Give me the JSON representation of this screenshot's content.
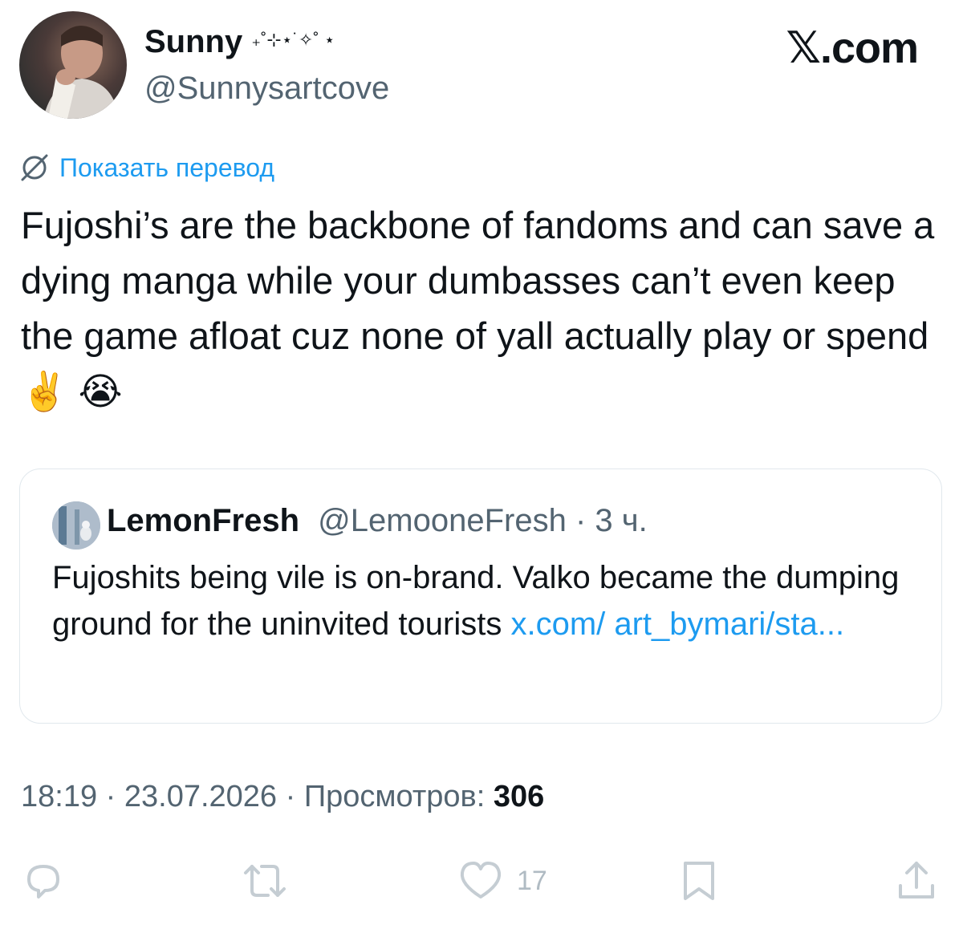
{
  "author": {
    "display_name": "Sunny",
    "name_decoration": "₊˚⊹⋆˙✧˚ ⋆",
    "handle": "@Sunnysartcove"
  },
  "brand": "𝕏.com",
  "translate_label": "Показать перевод",
  "tweet_text": "Fujoshi’s are the backbone of fandoms and can save a dying manga while your dumbasses can’t even keep the game afloat cuz none of yall actually play or spend ✌️ 😭",
  "quote": {
    "display_name": "LemonFresh",
    "handle": "@LemooneFresh",
    "separator": " · ",
    "time": "3 ч.",
    "text": "Fujoshits being vile is on-brand. Valko became the dumping ground for the uninvited tourists ",
    "link": "x.com/ art_bymari/sta..."
  },
  "meta": {
    "time": "18:19",
    "separator": " · ",
    "date": "23.07.2026",
    "views_label": "Просмотров:",
    "views_count": "306"
  },
  "actions": {
    "like_count": "17"
  },
  "colors": {
    "accent": "#1d9bf0",
    "secondary_text": "#536471",
    "icon_gray": "#c5cdd3"
  }
}
